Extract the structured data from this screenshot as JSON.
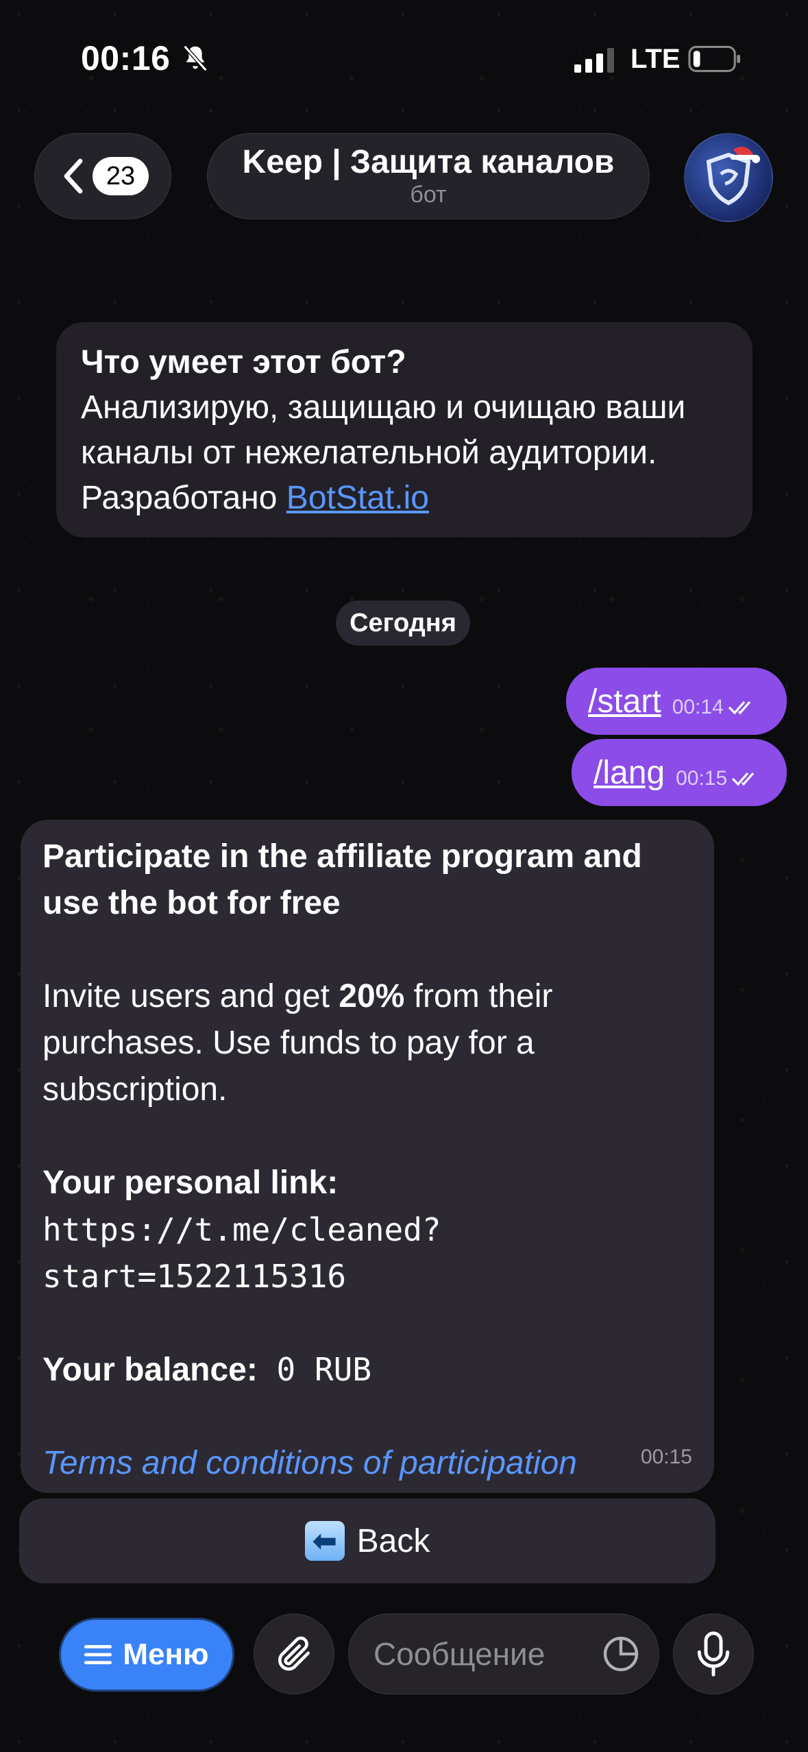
{
  "status_bar": {
    "time": "00:16",
    "network": "LTE"
  },
  "header": {
    "unread_count": "23",
    "title": "Keep | Защита каналов",
    "subtitle": "бот"
  },
  "intro": {
    "title": "Что умеет этот бот?",
    "line1": "Анализирую, защищаю и очищаю ваши",
    "line2": "каналы от нежелательной аудитории.",
    "line3_prefix": "Разработано ",
    "line3_link": "BotStat.io"
  },
  "date_separator": "Сегодня",
  "outgoing": [
    {
      "text": "/start",
      "time": "00:14"
    },
    {
      "text": "/lang",
      "time": "00:15"
    }
  ],
  "bot_message": {
    "title_line1": "Participate in the affiliate program and",
    "title_line2": "use the bot for free",
    "invite_prefix": "Invite users and get ",
    "invite_bold": "20%",
    "invite_suffix": " from their",
    "invite_line2": "purchases. Use funds to pay for a",
    "invite_line3": "subscription.",
    "link_label": "Your personal link:",
    "link_line1": "https://t.me/cleaned?",
    "link_line2": "start=1522115316",
    "balance_label": "Your balance:",
    "balance_value": " 0 RUB",
    "terms": "Terms and conditions of participation",
    "time": "00:15"
  },
  "keyboard": {
    "back_label": "Back"
  },
  "input_bar": {
    "menu_label": "Меню",
    "placeholder": "Сообщение"
  },
  "colors": {
    "accent": "#3a82f7",
    "outgoing_bubble": "#8b4ce8",
    "link": "#5a97ff"
  }
}
